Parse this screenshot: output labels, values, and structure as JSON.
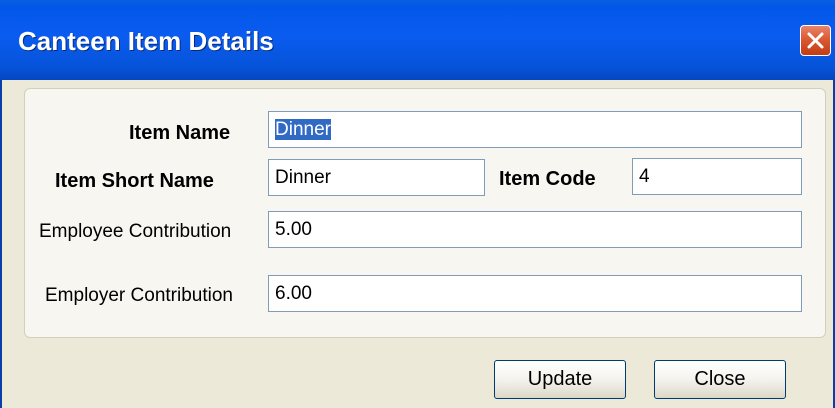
{
  "window": {
    "title": "Canteen Item Details",
    "close_icon": "close-icon"
  },
  "form": {
    "item_name": {
      "label": "Item Name",
      "value": "Dinner"
    },
    "item_short_name": {
      "label": "Item Short Name",
      "value": "Dinner"
    },
    "item_code": {
      "label": "Item Code",
      "value": "4"
    },
    "employee_contribution": {
      "label": "Employee Contribution",
      "value": "5.00"
    },
    "employer_contribution": {
      "label": "Employer Contribution",
      "value": "6.00"
    }
  },
  "buttons": {
    "update_label": "Update",
    "close_label": "Close"
  },
  "colors": {
    "titlebar": "#0a5cf0",
    "close_button": "#d9572f",
    "window_bg": "#ece9d8",
    "selection": "#316ac5",
    "field_border": "#7f9db9"
  }
}
